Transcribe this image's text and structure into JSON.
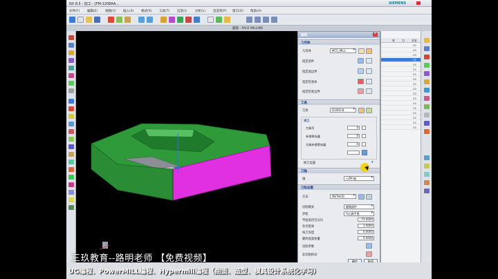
{
  "titlebar": {
    "app_title": "NX 8.5 - 加工 - [FM-1208AA...",
    "brand": "SIEMENS"
  },
  "menu": [
    "文件(F)",
    "编辑(E)",
    "视图(V)",
    "插入(S)",
    "格式(R)",
    "工具(T)",
    "信息(I)",
    "分析(L)",
    "首选项(P)",
    "窗口(O)",
    "帮助(H)"
  ],
  "viewport": {
    "operation_label": "面铣 - FACE MILLING"
  },
  "dialog": {
    "title": "面铣",
    "geometry_section": "几何体",
    "geometry_label": "几何体",
    "geometry_value": "MCS_MILL",
    "specify_part": "指定部件",
    "specify_face_boundary": "指定面边界",
    "specify_check": "指定检查体",
    "specify_check_boundary": "指定检查边界",
    "tool_section": "工具",
    "tool_label": "刀具",
    "tool_value": "D10R0.8",
    "output_section": "输出",
    "output_fields": [
      {
        "label": "刀具号",
        "value": "0"
      },
      {
        "label": "补偿寄存器",
        "value": "0"
      },
      {
        "label": "刀具补偿寄存器",
        "value": "0"
      }
    ],
    "tool_change": "换刀设置",
    "axis_section": "刀轴",
    "axis_label": "轴",
    "axis_value": "+ZM 轴",
    "track_section": "刀轨设置",
    "method_label": "方法",
    "method_value": "METHOD",
    "cut_mode_label": "切削模式",
    "cut_mode_value": "跟随部件",
    "stepover_label": "步距",
    "stepover_value": "%刀具平直",
    "flat_diameter_label": "平面直径百分比",
    "flat_diameter_value": "75.0000",
    "blank_distance_label": "毛坯距离",
    "blank_distance_value": "3.0000",
    "depth_label": "每刀深度",
    "depth_value": "0.0000",
    "final_floor_label": "最终底面余量",
    "final_floor_value": "0.0000",
    "cut_params_label": "切削参数",
    "non_cut_label": "非切削移动",
    "ok_label": "确定",
    "cancel_label": "取消"
  },
  "right_panel": {
    "header": [
      "名",
      "刀",
      "方法"
    ],
    "rows": [
      "C0",
      "C0",
      "C0",
      "C0",
      "C0",
      "C0",
      "C0",
      "C0",
      "C0",
      "C0",
      "C0",
      "C0",
      "C0",
      "C0",
      "C0",
      "C0",
      "C0",
      "C0"
    ]
  },
  "watermark": {
    "line1": "三玖教育--路明老师  【免费视频】",
    "line2": "UG编程、PowerMILL编程、Hypermill编程（曲面、造型、模具设计系统化学习）"
  },
  "colors": {
    "part_green": "#2e9a3a",
    "part_magenta": "#e030e0",
    "highlight_blue": "#2f6fe0",
    "cursor_yellow": "#f2d200"
  }
}
